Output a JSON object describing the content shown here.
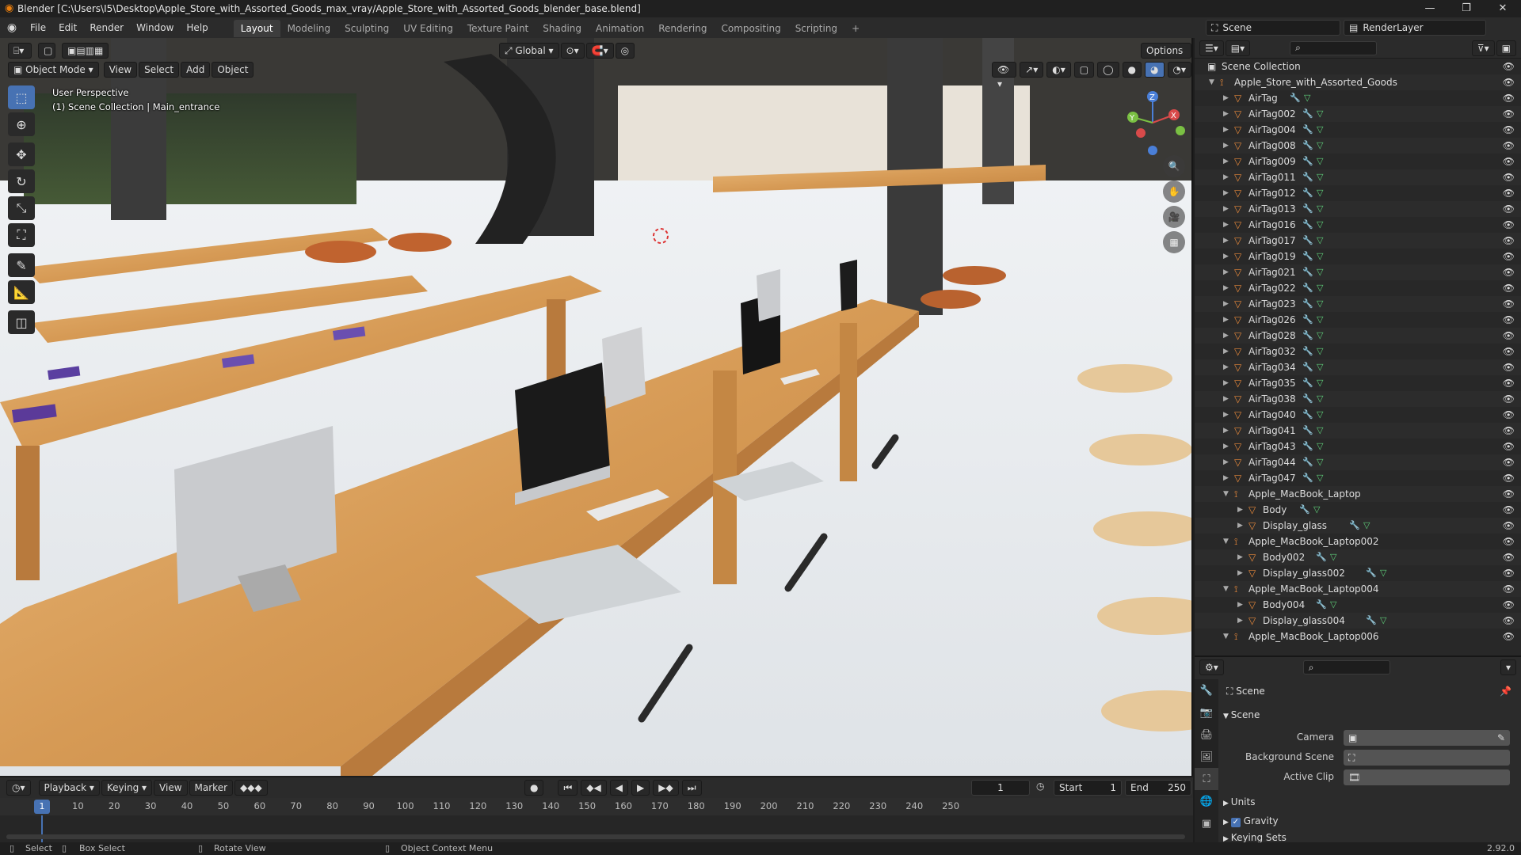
{
  "window": {
    "title": "Blender [C:\\Users\\I5\\Desktop\\Apple_Store_with_Assorted_Goods_max_vray/Apple_Store_with_Assorted_Goods_blender_base.blend]",
    "controls": [
      "—",
      "❐",
      "✕"
    ]
  },
  "menu": [
    "File",
    "Edit",
    "Render",
    "Window",
    "Help"
  ],
  "workspaces": [
    "Layout",
    "Modeling",
    "Sculpting",
    "UV Editing",
    "Texture Paint",
    "Shading",
    "Animation",
    "Rendering",
    "Compositing",
    "Scripting"
  ],
  "active_workspace": "Layout",
  "scene_selector": "Scene",
  "view_layer": "RenderLayer",
  "viewport": {
    "mode": "Object Mode",
    "menus": [
      "View",
      "Select",
      "Add",
      "Object"
    ],
    "transform_orientation": "Global",
    "options_label": "Options",
    "overlay_line1": "User Perspective",
    "overlay_line2": "(1) Scene Collection | Main_entrance",
    "gizmo_axes": [
      "X",
      "Y",
      "Z"
    ]
  },
  "outliner": {
    "root": "Scene Collection",
    "collection": "Apple_Store_with_Assorted_Goods",
    "airtags": [
      "AirTag",
      "AirTag002",
      "AirTag004",
      "AirTag008",
      "AirTag009",
      "AirTag011",
      "AirTag012",
      "AirTag013",
      "AirTag016",
      "AirTag017",
      "AirTag019",
      "AirTag021",
      "AirTag022",
      "AirTag023",
      "AirTag026",
      "AirTag028",
      "AirTag032",
      "AirTag034",
      "AirTag035",
      "AirTag038",
      "AirTag040",
      "AirTag041",
      "AirTag043",
      "AirTag044",
      "AirTag047"
    ],
    "groups": [
      {
        "name": "Apple_MacBook_Laptop",
        "children": [
          "Body",
          "Display_glass"
        ]
      },
      {
        "name": "Apple_MacBook_Laptop002",
        "children": [
          "Body002",
          "Display_glass002"
        ]
      },
      {
        "name": "Apple_MacBook_Laptop004",
        "children": [
          "Body004",
          "Display_glass004"
        ]
      },
      {
        "name": "Apple_MacBook_Laptop006",
        "children": []
      }
    ]
  },
  "properties": {
    "context": "Scene",
    "panel": "Scene",
    "camera_label": "Camera",
    "background_label": "Background Scene",
    "clip_label": "Active Clip",
    "units_label": "Units",
    "gravity_label": "Gravity",
    "keying_label": "Keying Sets"
  },
  "timeline": {
    "menus": [
      "Playback",
      "Keying",
      "View",
      "Marker"
    ],
    "current_frame": "1",
    "start_label": "Start",
    "start": "1",
    "end_label": "End",
    "end": "250",
    "ticks": [
      "10",
      "20",
      "30",
      "40",
      "50",
      "60",
      "70",
      "80",
      "90",
      "100",
      "110",
      "120",
      "130",
      "140",
      "150",
      "160",
      "170",
      "180",
      "190",
      "200",
      "210",
      "220",
      "230",
      "240",
      "250"
    ],
    "playhead": "1"
  },
  "statusbar": {
    "select": "Select",
    "box_select": "Box Select",
    "rotate": "Rotate View",
    "context_menu": "Object Context Menu",
    "version": "2.92.0"
  }
}
